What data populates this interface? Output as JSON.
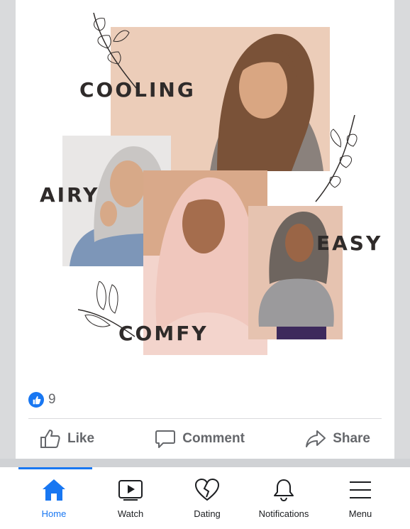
{
  "post": {
    "words": {
      "cooling": "COOLING",
      "airy": "AIRY",
      "easy": "EASY",
      "comfy": "COMFY"
    },
    "reactions": {
      "icon": "thumbs-up-icon",
      "count": "9"
    },
    "actions": {
      "like": "Like",
      "comment": "Comment",
      "share": "Share"
    }
  },
  "tabbar": {
    "tabs": [
      {
        "label": "Home",
        "icon": "home-icon",
        "active": true
      },
      {
        "label": "Watch",
        "icon": "video-icon",
        "active": false
      },
      {
        "label": "Dating",
        "icon": "heart-icon",
        "active": false
      },
      {
        "label": "Notifications",
        "icon": "bell-icon",
        "active": false
      },
      {
        "label": "Menu",
        "icon": "menu-icon",
        "active": false
      }
    ]
  },
  "colors": {
    "accent": "#1877f2",
    "secondary_text": "#65676b",
    "panel_peach": "#eccdb9",
    "panel_tan": "#d9a98a"
  }
}
